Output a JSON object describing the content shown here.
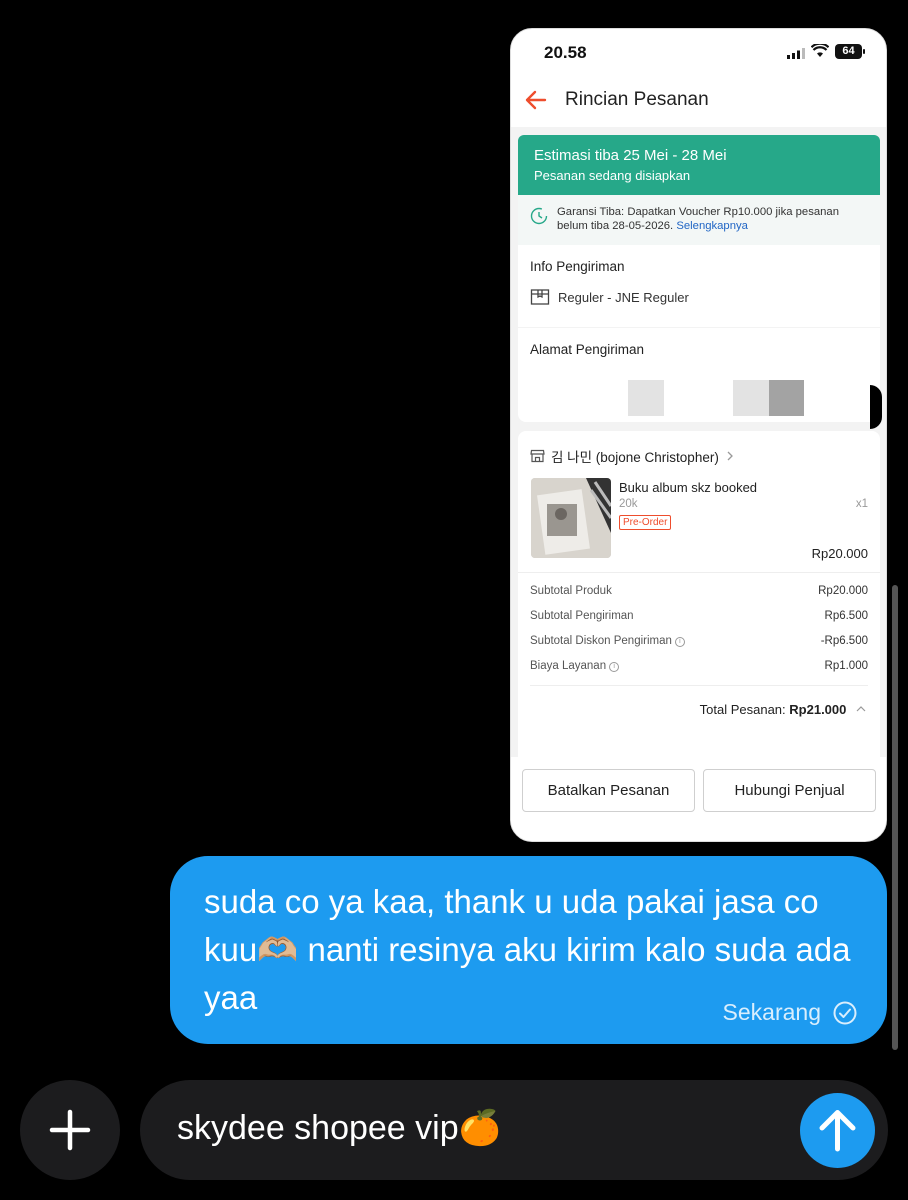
{
  "screenshot": {
    "status_bar": {
      "time": "20.58",
      "battery": "64"
    },
    "app_bar": {
      "title": "Rincian Pesanan"
    },
    "eta": {
      "title": "Estimasi tiba 25 Mei - 28 Mei",
      "subtitle": "Pesanan sedang disiapkan"
    },
    "garansi": {
      "text": "Garansi Tiba: Dapatkan Voucher Rp10.000 jika pesanan belum tiba 28-05-2026.",
      "link": "Selengkapnya"
    },
    "shipping_info": {
      "title": "Info Pengiriman",
      "method": "Reguler - JNE Reguler"
    },
    "address": {
      "title": "Alamat Pengiriman"
    },
    "shop": {
      "name": "김 나민 (bojone Christopher)",
      "product": {
        "name": "Buku album skz booked",
        "variant": "20k",
        "badge": "Pre-Order",
        "qty": "x1",
        "price": "Rp20.000"
      },
      "summary": [
        {
          "label": "Subtotal Produk",
          "value": "Rp20.000",
          "info": false
        },
        {
          "label": "Subtotal Pengiriman",
          "value": "Rp6.500",
          "info": false
        },
        {
          "label": "Subtotal Diskon Pengiriman",
          "value": "-Rp6.500",
          "info": true
        },
        {
          "label": "Biaya Layanan",
          "value": "Rp1.000",
          "info": true
        }
      ],
      "total_label": "Total Pesanan:",
      "total_value": "Rp21.000"
    },
    "buttons": {
      "cancel": "Batalkan Pesanan",
      "contact": "Hubungi Penjual"
    }
  },
  "message": {
    "text": "suda co ya kaa, thank u uda pakai jasa co kuu🫶🏼 nanti resinya aku kirim kalo suda ada yaa",
    "status": "Sekarang"
  },
  "composer": {
    "text": "skydee shopee vip🍊"
  },
  "colors": {
    "accent": "#1d9bf0",
    "shopee_orange": "#ee4d2d",
    "eta_green": "#26a889"
  }
}
